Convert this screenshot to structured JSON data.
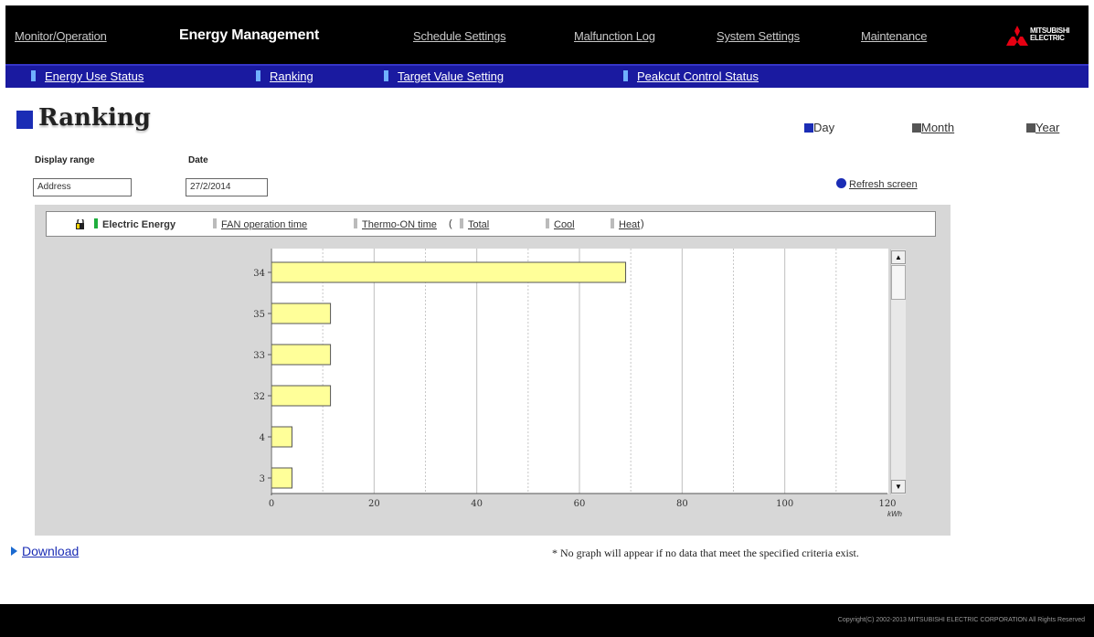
{
  "nav": {
    "items": [
      {
        "label": "Monitor/Operation",
        "active": false
      },
      {
        "label": "Energy Management",
        "active": true
      },
      {
        "label": "Schedule Settings",
        "active": false
      },
      {
        "label": "Malfunction Log",
        "active": false
      },
      {
        "label": "System Settings",
        "active": false
      },
      {
        "label": "Maintenance",
        "active": false
      }
    ],
    "logo_text_1": "MITSUBISHI",
    "logo_text_2": "ELECTRIC",
    "logo_color": "#e60012"
  },
  "subnav": {
    "items": [
      {
        "label": "Energy Use Status"
      },
      {
        "label": "Ranking"
      },
      {
        "label": "Target Value Setting"
      },
      {
        "label": "Peakcut Control Status"
      }
    ]
  },
  "page": {
    "title": "Ranking",
    "periods": [
      {
        "label": "Day",
        "selected": true
      },
      {
        "label": "Month",
        "selected": false
      },
      {
        "label": "Year",
        "selected": false
      }
    ]
  },
  "filters": {
    "display_range_label": "Display range",
    "display_range_value": "Address",
    "date_label": "Date",
    "date_value": "27/2/2014",
    "refresh_label": "Refresh screen"
  },
  "legend": {
    "electric_energy": "Electric Energy",
    "fan_operation_time": "FAN operation time",
    "thermo_on_time": "Thermo-ON time",
    "open_paren": "(",
    "total": "Total",
    "cool": "Cool",
    "heat": "Heat",
    "close_paren": ")"
  },
  "chart_data": {
    "type": "bar",
    "orientation": "horizontal",
    "categories": [
      "34",
      "35",
      "33",
      "32",
      "4",
      "3"
    ],
    "values": [
      69,
      11.5,
      11.5,
      11.5,
      4,
      4
    ],
    "xlim": [
      0,
      120
    ],
    "xticks": [
      0,
      20,
      40,
      60,
      80,
      100,
      120
    ],
    "xunit": "kWh",
    "bar_color": "#ffff99",
    "grid": true
  },
  "footer": {
    "download_label": "Download",
    "note": "* No graph will appear if no data that meet the specified criteria exist.",
    "copyright": "Copyright(C) 2002-2013 MITSUBISHI ELECTRIC CORPORATION All Rights Reserved"
  }
}
